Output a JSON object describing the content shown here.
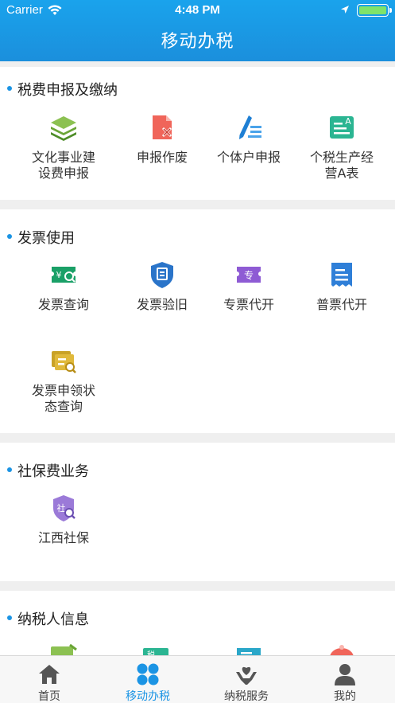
{
  "status_bar": {
    "carrier": "Carrier",
    "time": "4:48 PM"
  },
  "nav": {
    "title": "移动办税"
  },
  "sections": [
    {
      "title": "税费申报及缴纳",
      "items": [
        {
          "line1": "文化事业建",
          "line2": "设费申报",
          "icon": "stack-layers-icon"
        },
        {
          "line1": "申报作废",
          "line2": "",
          "icon": "document-cancel-icon"
        },
        {
          "line1": "个体户申报",
          "line2": "",
          "icon": "pen-lines-icon"
        },
        {
          "line1": "个税生产经",
          "line2": "营A表",
          "icon": "form-a-icon"
        }
      ]
    },
    {
      "title": "发票使用",
      "items": [
        {
          "line1": "发票查询",
          "line2": "",
          "icon": "invoice-search-icon"
        },
        {
          "line1": "发票验旧",
          "line2": "",
          "icon": "shield-check-icon"
        },
        {
          "line1": "专票代开",
          "line2": "",
          "icon": "special-ticket-icon"
        },
        {
          "line1": "普票代开",
          "line2": "",
          "icon": "receipt-icon"
        },
        {
          "line1": "发票申领状",
          "line2": "态查询",
          "icon": "invoice-status-icon"
        }
      ]
    },
    {
      "title": "社保费业务",
      "items": [
        {
          "line1": "江西社保",
          "line2": "",
          "icon": "social-security-shield-icon",
          "glyph": "社"
        }
      ]
    },
    {
      "title": "纳税人信息",
      "items": []
    }
  ],
  "tabbar": [
    {
      "label": "首页",
      "icon": "home-icon",
      "active": false
    },
    {
      "label": "移动办税",
      "icon": "grid-dots-icon",
      "active": true
    },
    {
      "label": "纳税服务",
      "icon": "hands-heart-icon",
      "active": false
    },
    {
      "label": "我的",
      "icon": "user-icon",
      "active": false
    }
  ],
  "colors": {
    "primary": "#1b94e4",
    "header_top": "#1aa3ec",
    "background": "#efefef"
  }
}
